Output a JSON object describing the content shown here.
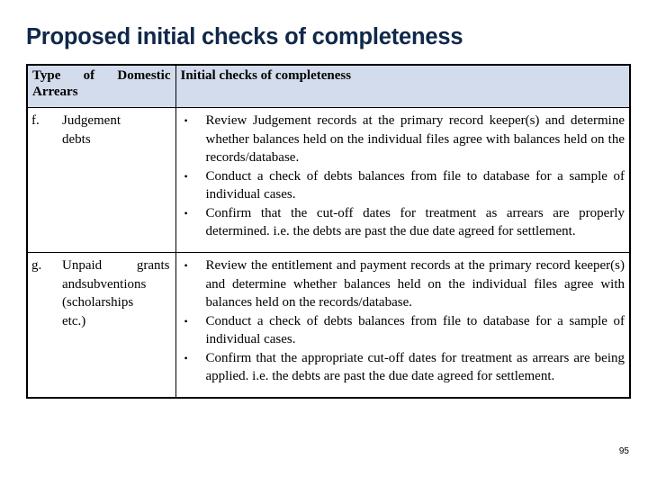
{
  "slide": {
    "title": "Proposed initial checks of completeness",
    "page_number": "95",
    "accent_color": "#10284a",
    "header_fill": "#d3dcec"
  },
  "table": {
    "headers": {
      "col1": "Type of Domestic Arrears",
      "col2": "Initial checks of completeness"
    },
    "rows": [
      {
        "marker": "f.",
        "label_lines": [
          "Judgement",
          "debts"
        ],
        "bullets": [
          "Review Judgement records at the primary record keeper(s) and determine whether balances held on the individual files agree with balances held on the records/database.",
          "Conduct a check of debts balances from file to database for a sample of individual cases.",
          "Confirm that the cut-off dates for treatment as arrears are properly determined. i.e. the debts are past the due date agreed for settlement."
        ]
      },
      {
        "marker": "g.",
        "label_lines": [
          "Unpaid grants",
          "andsubventions",
          "(scholarships",
          "etc.)"
        ],
        "bullets": [
          "Review the entitlement and payment records at the primary record keeper(s) and determine whether balances held on the individual files agree with balances held on the records/database.",
          "Conduct a check of debts balances from file to database for a sample of individual cases.",
          "Confirm that the appropriate cut-off dates for treatment as arrears are being applied. i.e. the debts are past the due date agreed for settlement."
        ]
      }
    ],
    "bullet_glyph": "•"
  }
}
